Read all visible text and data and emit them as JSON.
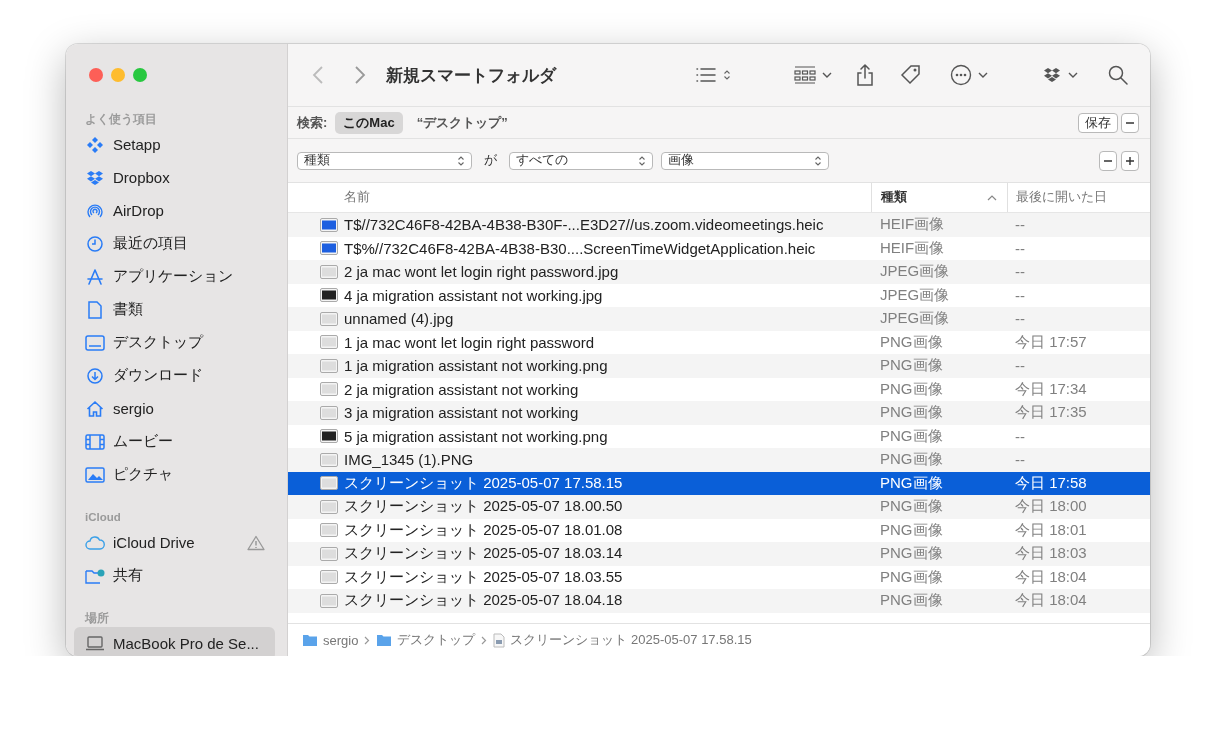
{
  "window": {
    "title": "新規スマートフォルダ"
  },
  "sidebar": {
    "sections": [
      {
        "heading": "よく使う項目",
        "items": [
          {
            "label": "Setapp",
            "selected": false,
            "warning": false
          },
          {
            "label": "Dropbox",
            "selected": false,
            "warning": false
          },
          {
            "label": "AirDrop",
            "selected": false,
            "warning": false
          },
          {
            "label": "最近の項目",
            "selected": false,
            "warning": false
          },
          {
            "label": "アプリケーション",
            "selected": false,
            "warning": false
          },
          {
            "label": "書類",
            "selected": false,
            "warning": false
          },
          {
            "label": "デスクトップ",
            "selected": false,
            "warning": false
          },
          {
            "label": "ダウンロード",
            "selected": false,
            "warning": false
          },
          {
            "label": "sergio",
            "selected": false,
            "warning": false
          },
          {
            "label": "ムービー",
            "selected": false,
            "warning": false
          },
          {
            "label": "ピクチャ",
            "selected": false,
            "warning": false
          }
        ]
      },
      {
        "heading": "iCloud",
        "items": [
          {
            "label": "iCloud Drive",
            "selected": false,
            "warning": true
          },
          {
            "label": "共有",
            "selected": false,
            "warning": false
          }
        ]
      },
      {
        "heading": "場所",
        "items": [
          {
            "label": "MacBook Pro de Se...",
            "selected": true,
            "warning": false
          }
        ]
      }
    ]
  },
  "search_bar": {
    "label": "検索:",
    "scopes": [
      {
        "label": "このMac",
        "selected": true
      },
      {
        "label": "“デスクトップ”",
        "selected": false
      }
    ],
    "save_button": "保存"
  },
  "criteria": {
    "attribute": "種類",
    "connector": "が",
    "operator": "すべての",
    "value": "画像"
  },
  "table": {
    "columns": [
      {
        "label": "名前",
        "sorted": false
      },
      {
        "label": "種類",
        "sorted": true
      },
      {
        "label": "最後に開いた日",
        "sorted": false
      }
    ],
    "rows": [
      {
        "name": "T$//732C46F8-42BA-4B38-B30F-...E3D27//us.zoom.videomeetings.heic",
        "kind": "HEIF画像",
        "opened": "--",
        "selected": false
      },
      {
        "name": "T$%//732C46F8-42BA-4B38-B30....ScreenTimeWidgetApplication.heic",
        "kind": "HEIF画像",
        "opened": "--",
        "selected": false
      },
      {
        "name": "2 ja mac wont let login right password.jpg",
        "kind": "JPEG画像",
        "opened": "--",
        "selected": false
      },
      {
        "name": "4 ja migration assistant not working.jpg",
        "kind": "JPEG画像",
        "opened": "--",
        "selected": false
      },
      {
        "name": "unnamed (4).jpg",
        "kind": "JPEG画像",
        "opened": "--",
        "selected": false
      },
      {
        "name": "1 ja mac wont let login right password",
        "kind": "PNG画像",
        "opened": "今日 17:57",
        "selected": false
      },
      {
        "name": "1 ja migration assistant not working.png",
        "kind": "PNG画像",
        "opened": "--",
        "selected": false
      },
      {
        "name": "2 ja migration assistant not working",
        "kind": "PNG画像",
        "opened": "今日 17:34",
        "selected": false
      },
      {
        "name": "3 ja migration assistant not working",
        "kind": "PNG画像",
        "opened": "今日 17:35",
        "selected": false
      },
      {
        "name": "5 ja migration assistant not working.png",
        "kind": "PNG画像",
        "opened": "--",
        "selected": false
      },
      {
        "name": "IMG_1345 (1).PNG",
        "kind": "PNG画像",
        "opened": "--",
        "selected": false
      },
      {
        "name": "スクリーンショット 2025-05-07 17.58.15",
        "kind": "PNG画像",
        "opened": "今日 17:58",
        "selected": true
      },
      {
        "name": "スクリーンショット 2025-05-07 18.00.50",
        "kind": "PNG画像",
        "opened": "今日 18:00",
        "selected": false
      },
      {
        "name": "スクリーンショット 2025-05-07 18.01.08",
        "kind": "PNG画像",
        "opened": "今日 18:01",
        "selected": false
      },
      {
        "name": "スクリーンショット 2025-05-07 18.03.14",
        "kind": "PNG画像",
        "opened": "今日 18:03",
        "selected": false
      },
      {
        "name": "スクリーンショット 2025-05-07 18.03.55",
        "kind": "PNG画像",
        "opened": "今日 18:04",
        "selected": false
      },
      {
        "name": "スクリーンショット 2025-05-07 18.04.18",
        "kind": "PNG画像",
        "opened": "今日 18:04",
        "selected": false
      }
    ]
  },
  "path_bar": [
    {
      "label": "sergio",
      "kind": "folder"
    },
    {
      "label": "デスクトップ",
      "kind": "folder"
    },
    {
      "label": "スクリーンショット 2025-05-07 17.58.15",
      "kind": "file"
    }
  ]
}
